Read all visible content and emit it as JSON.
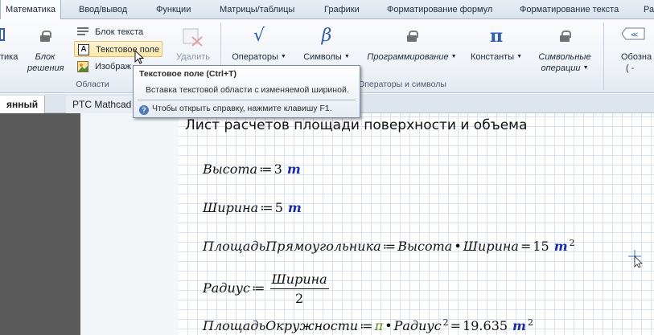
{
  "ribbon_tabs": [
    {
      "label": "Математика",
      "active": true
    },
    {
      "label": "Ввод/вывод"
    },
    {
      "label": "Функции"
    },
    {
      "label": "Матрицы/таблицы"
    },
    {
      "label": "Графики"
    },
    {
      "label": "Форматирование формул"
    },
    {
      "label": "Форматирование текста"
    },
    {
      "label": "Ра"
    }
  ],
  "regions_group": {
    "cut_label_left": "тика",
    "solve_block": {
      "line1": "Блок",
      "line2": "решения"
    },
    "text_block": "Блок текста",
    "text_box": "Текстовое поле",
    "image": "Изображ",
    "delete": "Удалить",
    "group_label": "Области"
  },
  "operators_group": {
    "operators": "Операторы",
    "symbols": "Символы",
    "programming": "Программирование",
    "constants": "Константы",
    "symbolic_ops": {
      "line1": "Символьные",
      "line2": "операции"
    },
    "group_label": "Операторы и символы"
  },
  "right_cut": {
    "line1": "Обозна",
    "line2": "( -"
  },
  "icons": {
    "operators": "√",
    "symbols": "β",
    "constants": "π"
  },
  "doc_tabs": [
    {
      "label": "янный"
    },
    {
      "label": "PTC Mathcad"
    }
  ],
  "tooltip": {
    "title": "Текстовое поле (Ctrl+T)",
    "description": "Вставка текстовой области с изменяемой шириной.",
    "help": "Чтобы открыть справку, нажмите клавишу F1."
  },
  "worksheet": {
    "heading": "Лист расчетов площади поверхности и объема",
    "rows": [
      {
        "var": "Высота",
        "value": "3",
        "unit": "m"
      },
      {
        "var": "Ширина",
        "value": "5",
        "unit": "m"
      },
      {
        "var": "ПлощадьПрямоугольника",
        "left": "Высота",
        "right": "Ширина",
        "result": "15",
        "unit": "m",
        "exp": "2"
      },
      {
        "var": "Радиус",
        "num": "Ширина",
        "den": "2"
      },
      {
        "var": "ПлощадьОкружности",
        "pi": "π",
        "rvar": "Радиус",
        "rexp": "2",
        "result": "19.635",
        "unit": "m",
        "exp": "2"
      }
    ]
  },
  "colors": {
    "unit": "#1a2aa8",
    "pi": "#5f8d1a",
    "grid": "#d6e2ee",
    "ribbon_bg": "#eef2f7"
  }
}
